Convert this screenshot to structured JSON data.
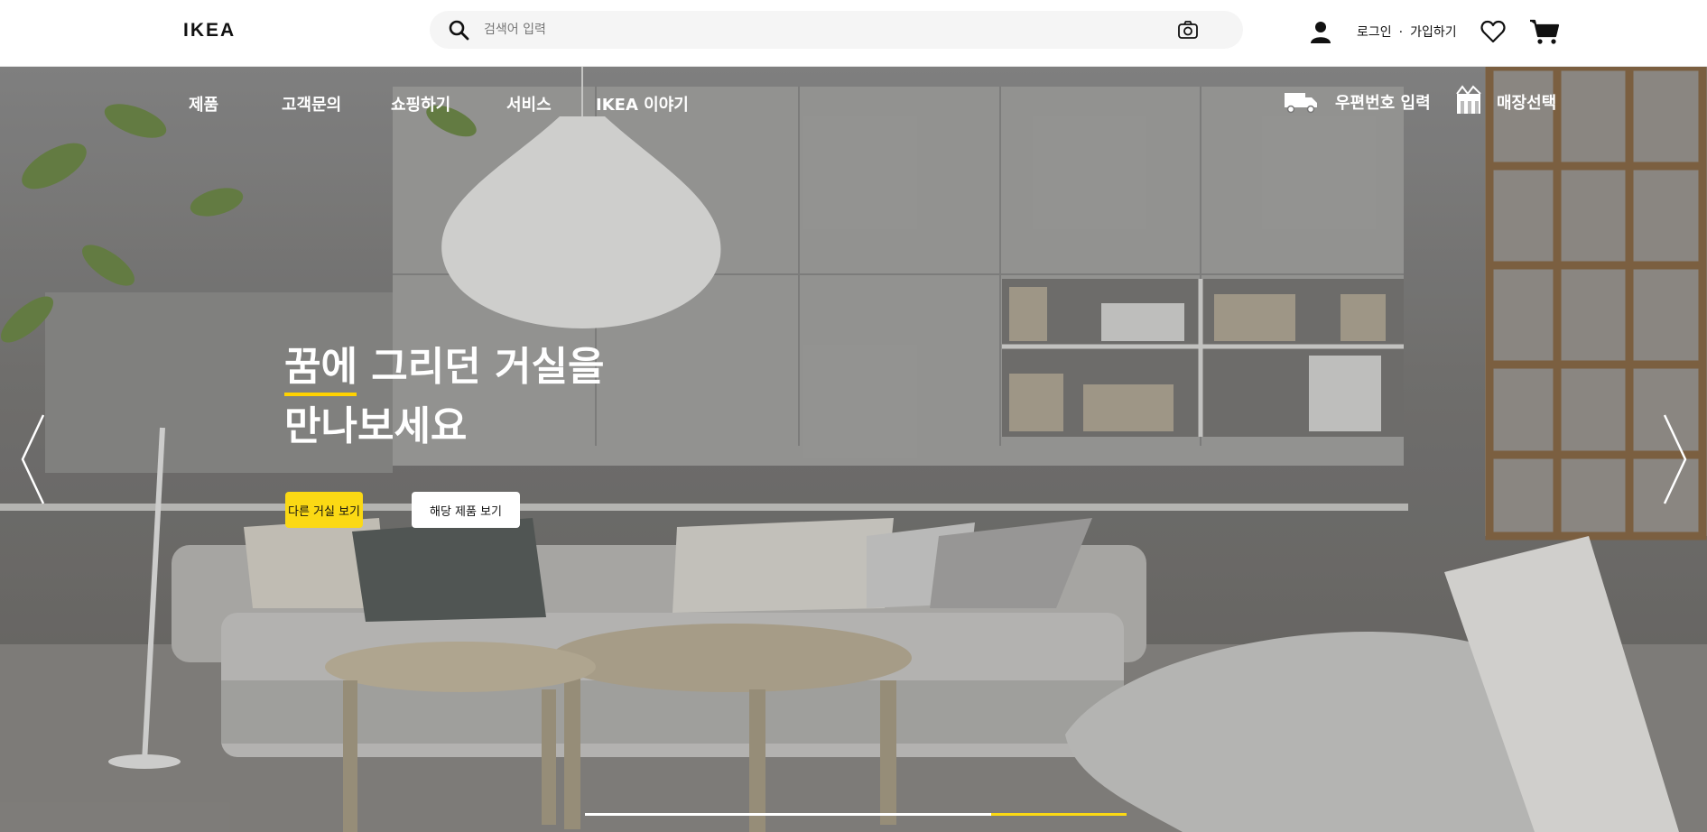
{
  "brand": {
    "logo_text": "IKEA"
  },
  "search": {
    "placeholder": "검색어 입력",
    "value": ""
  },
  "account": {
    "login_label": "로그인",
    "separator": "·",
    "signup_label": "가입하기"
  },
  "icons": {
    "search": "search-icon",
    "camera": "camera-icon",
    "user": "user-icon",
    "wishlist": "heart-icon",
    "cart": "cart-icon",
    "delivery": "truck-icon",
    "store": "store-icon",
    "prev": "chevron-left-icon",
    "next": "chevron-right-icon"
  },
  "nav": {
    "items": [
      {
        "label": "제품"
      },
      {
        "label": "고객문의"
      },
      {
        "label": "쇼핑하기"
      },
      {
        "label": "서비스"
      },
      {
        "label": "IKEA 이야기"
      }
    ],
    "postal_label": "우편번호 입력",
    "store_label": "매장선택"
  },
  "hero": {
    "headline_line1": "꿈에 그리던 거실을",
    "headline_line2": "만나보세요",
    "primary_button": "다른 거실 보기",
    "secondary_button": "해당 제품 보기",
    "progress": 0.25
  },
  "colors": {
    "accent": "#fbd914",
    "hero_overlay": "#7c7b79",
    "topbar": "#ffffff"
  }
}
